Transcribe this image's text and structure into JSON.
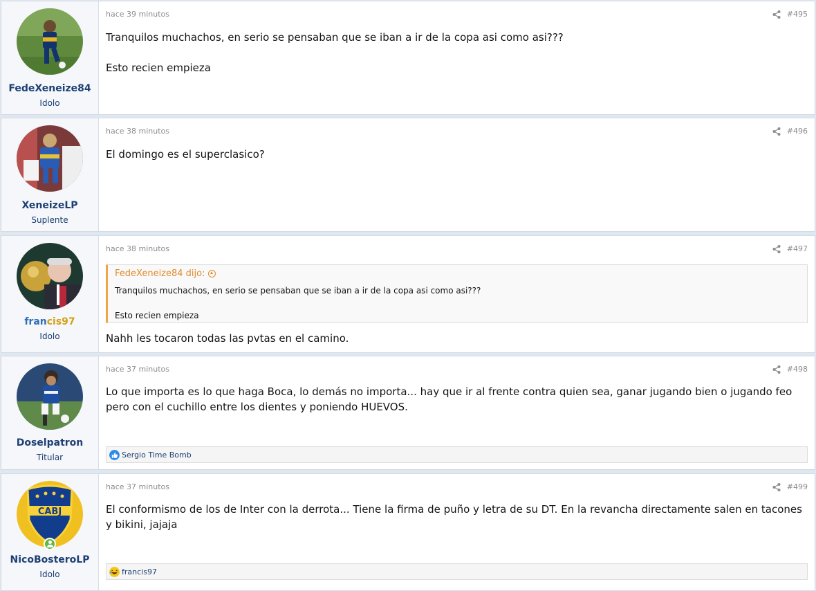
{
  "posts": [
    {
      "username": "FedeXeneize84",
      "user_title": "Idolo",
      "time": "hace 39 minutos",
      "number": "#495",
      "body": "Tranquilos muchachos, en serio se pensaban que se iban a ir de la copa asi como asi???\n\nEsto recien empieza"
    },
    {
      "username": "XeneizeLP",
      "user_title": "Suplente",
      "time": "hace 38 minutos",
      "number": "#496",
      "body": "El domingo es el superclasico?"
    },
    {
      "username": "francis97",
      "user_title": "Idolo",
      "time": "hace 38 minutos",
      "number": "#497",
      "quote_author": "FedeXeneize84 dijo:",
      "quote_text": "Tranquilos muchachos, en serio se pensaban que se iban a ir de la copa asi como asi???\n\nEsto recien empieza",
      "body": "Nahh les tocaron todas las pvtas en el camino."
    },
    {
      "username": "Doselpatron",
      "user_title": "Titular",
      "time": "hace 37 minutos",
      "number": "#498",
      "body": "Lo que importa es lo que haga Boca, lo demás no importa... hay que ir al frente contra quien sea, ganar jugando bien o jugando feo pero con el cuchillo entre los dientes y poniendo HUEVOS.",
      "reactions": "Sergio Time Bomb",
      "reaction_icon": "like-icon"
    },
    {
      "username": "NicoBosteroLP",
      "user_title": "Idolo",
      "time": "hace 37 minutos",
      "number": "#499",
      "body": "El conformismo de los de Inter con la derrota... Tiene la firma de puño y letra de su DT. En la revancha directamente salen en tacones y bikini, jajaja",
      "reactions": "francis97",
      "reaction_icon": "laugh-icon",
      "avatar_text": "CABJ"
    }
  ],
  "colors": {
    "username": "#1d3f73",
    "quote_accent": "#f0a54a",
    "online": "#63b83d"
  }
}
